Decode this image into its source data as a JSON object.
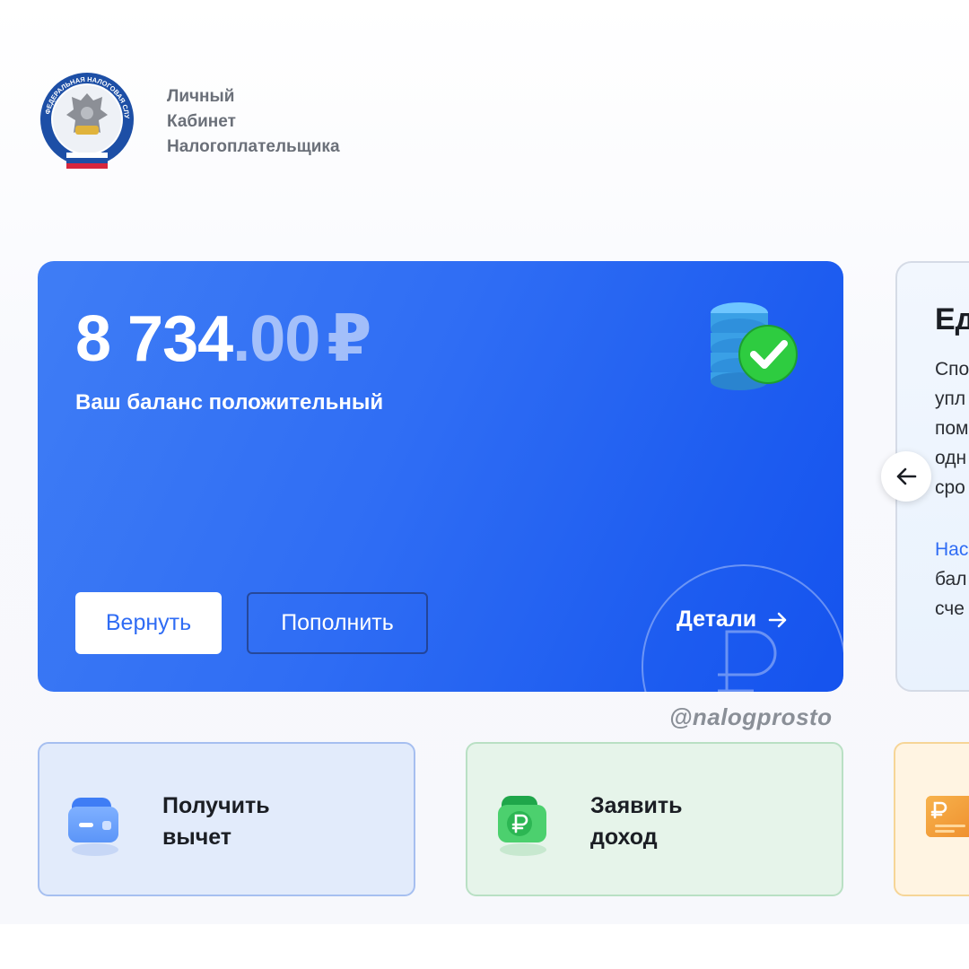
{
  "header": {
    "brand_line1": "Личный",
    "brand_line2": "Кабинет",
    "brand_line3": "Налогоплательщика",
    "logo_ring_text": "ФЕДЕРАЛЬНАЯ НАЛОГОВАЯ СЛУЖБА"
  },
  "balance": {
    "amount_int": "8 734",
    "amount_frac": ".00",
    "currency": "₽",
    "status": "Ваш баланс положительный",
    "return_label": "Вернуть",
    "topup_label": "Пополнить",
    "details_label": "Детали"
  },
  "side_card": {
    "title": "Ед",
    "lines": [
      "Спо",
      "упл",
      "пом",
      "одн",
      "сро"
    ],
    "link": "Нас",
    "tail_lines": [
      "бал",
      "сче"
    ]
  },
  "watermark": "@nalogprosto",
  "tiles": [
    {
      "line1": "Получить",
      "line2": "вычет"
    },
    {
      "line1": "Заявить",
      "line2": "доход"
    }
  ],
  "colors": {
    "accent": "#2f6cf4",
    "card_blue": "#2f6df4",
    "success": "#2ecc40"
  }
}
